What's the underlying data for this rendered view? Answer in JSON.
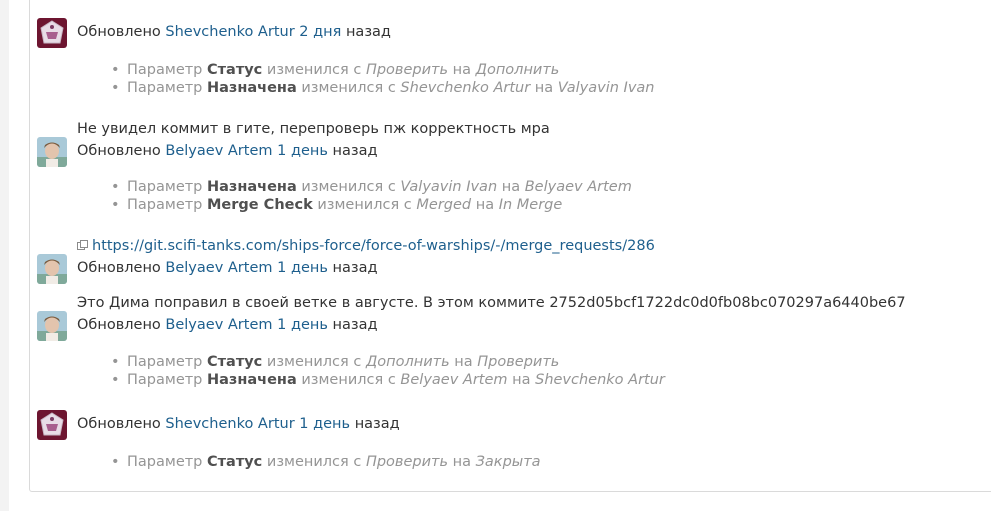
{
  "common": {
    "updated_label": "Обновлено",
    "ago_label": "назад",
    "param_label": "Параметр",
    "changed_label": "изменился с",
    "to_label": "на"
  },
  "journal": [
    {
      "author": "Shevchenko Artur",
      "age": "2 дня",
      "changes": [
        {
          "field": "Статус",
          "old": "Проверить",
          "new": "Дополнить"
        },
        {
          "field": "Назначена",
          "old": "Shevchenko Artur",
          "new": "Valyavin Ivan"
        }
      ]
    },
    {
      "note": "Не увидел коммит в гите, перепроверь пж корректность мра",
      "author": "Belyaev Artem",
      "age": "1 день",
      "changes": [
        {
          "field": "Назначена",
          "old": "Valyavin Ivan",
          "new": "Belyaev Artem"
        },
        {
          "field": "Merge Check",
          "old": "Merged",
          "new": "In Merge"
        }
      ]
    },
    {
      "note_link": "https://git.scifi-tanks.com/ships-force/force-of-warships/-/merge_requests/286",
      "author": "Belyaev Artem",
      "age": "1 день"
    },
    {
      "note": "Это Дима поправил в своей ветке в августе. В этом коммите 2752d05bcf1722dc0d0fb08bc070297a6440be67",
      "author": "Belyaev Artem",
      "age": "1 день",
      "changes": [
        {
          "field": "Статус",
          "old": "Дополнить",
          "new": "Проверить"
        },
        {
          "field": "Назначена",
          "old": "Belyaev Artem",
          "new": "Shevchenko Artur"
        }
      ]
    },
    {
      "author": "Shevchenko Artur",
      "age": "1 день",
      "changes": [
        {
          "field": "Статус",
          "old": "Проверить",
          "new": "Закрыта"
        }
      ]
    }
  ]
}
